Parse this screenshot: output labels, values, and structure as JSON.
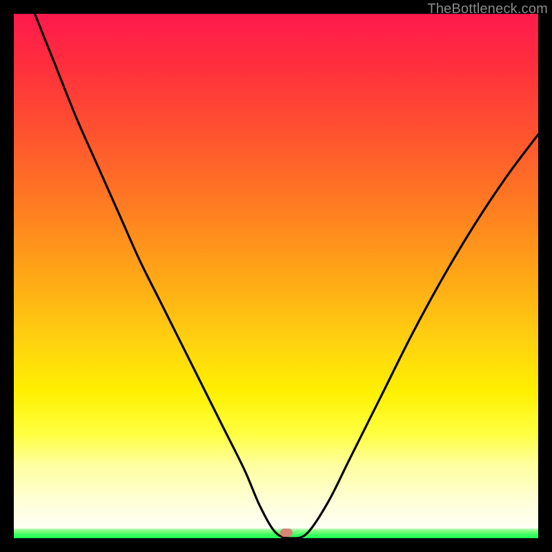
{
  "watermark": "TheBottleneck.com",
  "colors": {
    "frame": "#000000",
    "gradient_top": "#ff1a4d",
    "gradient_mid": "#ffd010",
    "gradient_bottom": "#ffffff",
    "green_band": "#1dff55",
    "curve": "#000000",
    "marker": "#d68578"
  },
  "chart_data": {
    "type": "line",
    "title": "",
    "xlabel": "",
    "ylabel": "",
    "xlim": [
      0,
      100
    ],
    "ylim": [
      0,
      100
    ],
    "grid": false,
    "annotations": {
      "watermark": "TheBottleneck.com",
      "marker_x": 52
    },
    "series": [
      {
        "name": "curve",
        "x": [
          4,
          8,
          12,
          16,
          20,
          24,
          28,
          32,
          36,
          40,
          44,
          47,
          50,
          53,
          56,
          60,
          64,
          70,
          76,
          82,
          88,
          94,
          100
        ],
        "y": [
          100,
          90,
          80,
          71,
          62,
          53,
          45,
          37,
          29,
          21,
          13,
          6,
          1,
          0,
          1,
          7,
          15,
          27,
          39,
          50,
          60,
          69,
          77
        ]
      }
    ]
  }
}
